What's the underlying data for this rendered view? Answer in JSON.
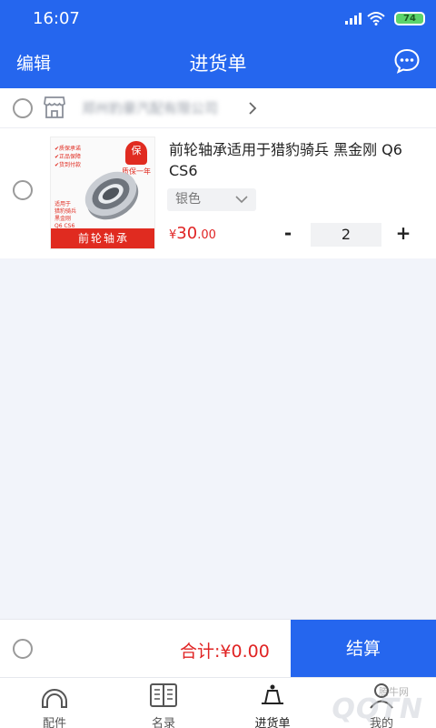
{
  "status_bar": {
    "time": "16:07",
    "battery": "74"
  },
  "header": {
    "edit_label": "编辑",
    "title": "进货单",
    "message_icon": "chat-bubble-icon"
  },
  "store": {
    "name": "郑州豹豪汽配有限公司",
    "icon": "shop-icon"
  },
  "items": [
    {
      "name": "前轮轴承适用于猎豹骑兵 黑金刚 Q6 CS6",
      "variant": "银色",
      "price_symbol": "¥",
      "price_int": "30",
      "price_dec": ".00",
      "quantity": "2",
      "minus_label": "-",
      "plus_label": "+",
      "thumb": {
        "banner": "前轮轴承",
        "badge": "保",
        "badge_caption": "质保一年",
        "feature_lines": [
          "✔质保承诺",
          "✔正品保障",
          "✔货到付款"
        ],
        "fit_lines": [
          "适用于",
          "猎豹骑兵",
          "黑金刚",
          "Q6 CS6"
        ]
      }
    }
  ],
  "checkout": {
    "total_label": "合计:",
    "total_value": "¥0.00",
    "button_label": "结算"
  },
  "tabs": [
    {
      "label": "配件",
      "icon": "parts-icon"
    },
    {
      "label": "名录",
      "icon": "directory-icon"
    },
    {
      "label": "进货单",
      "icon": "purchase-order-icon"
    },
    {
      "label": "我的",
      "icon": "profile-icon"
    }
  ],
  "watermark": {
    "site": "腾牛网",
    "mark": "QQTN"
  },
  "colors": {
    "primary": "#2566ee",
    "price": "#e02424",
    "background": "#f2f4fa"
  }
}
